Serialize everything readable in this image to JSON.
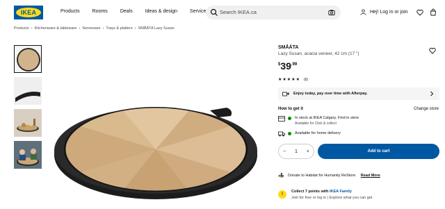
{
  "header": {
    "logo_text": "IKEA",
    "nav": [
      "Products",
      "Rooms",
      "Deals",
      "Ideas & design",
      "Services"
    ],
    "search_placeholder": "Search IKEA.ca",
    "login_label": "Hej! Log in or join"
  },
  "breadcrumb": [
    "Products",
    "Kitchenware & tableware",
    "Serveware",
    "Trays & platters",
    "SMÅÄTA Lazy Susan"
  ],
  "product": {
    "name": "SMÅÄTA",
    "description": "Lazy Susan, acacia veneer, 42 cm (17 \")",
    "price_currency": "$",
    "price_integer": "39",
    "price_decimal": ".99",
    "rating_stars": 5,
    "review_count": "(6)"
  },
  "afterpay": {
    "text": "Enjoy today, pay over time with Afterpay."
  },
  "how_to_get": {
    "title": "How to get it",
    "change_store": "Change store",
    "instore_line": "In stock at IKEA Calgary. Find in store",
    "instore_sub": "Available for Click & collect",
    "delivery_line": "Available for home delivery"
  },
  "purchase": {
    "quantity": "1",
    "add_to_cart": "Add to cart"
  },
  "donate": {
    "text": "Donate to Habitat for Humanity ReStore.",
    "read_more": "Read More"
  },
  "family": {
    "line1_prefix": "Collect 7 points with",
    "line1_link": "IKEA Family",
    "line2": "Join for free or log in | Explore what you can get"
  },
  "colors": {
    "brand_blue": "#0058a3",
    "brand_yellow": "#ffda1a",
    "stock_green": "#0a8a00"
  }
}
